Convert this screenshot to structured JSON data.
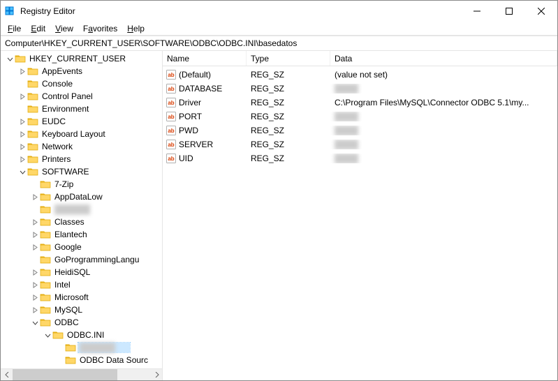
{
  "window": {
    "title": "Registry Editor"
  },
  "menu": {
    "file": "File",
    "edit": "Edit",
    "view": "View",
    "favorites": "Favorites",
    "help": "Help"
  },
  "address": "Computer\\HKEY_CURRENT_USER\\SOFTWARE\\ODBC\\ODBC.INI\\basedatos",
  "columns": {
    "name": "Name",
    "type": "Type",
    "data": "Data"
  },
  "tree": {
    "root": "HKEY_CURRENT_USER",
    "children": [
      {
        "label": "AppEvents",
        "expander": ">",
        "indent": 1
      },
      {
        "label": "Console",
        "expander": "",
        "indent": 1
      },
      {
        "label": "Control Panel",
        "expander": ">",
        "indent": 1
      },
      {
        "label": "Environment",
        "expander": "",
        "indent": 1
      },
      {
        "label": "EUDC",
        "expander": ">",
        "indent": 1
      },
      {
        "label": "Keyboard Layout",
        "expander": ">",
        "indent": 1
      },
      {
        "label": "Network",
        "expander": ">",
        "indent": 1
      },
      {
        "label": "Printers",
        "expander": ">",
        "indent": 1
      },
      {
        "label": "SOFTWARE",
        "expander": "v",
        "indent": 1
      },
      {
        "label": "7-Zip",
        "expander": "",
        "indent": 2
      },
      {
        "label": "AppDataLow",
        "expander": ">",
        "indent": 2
      },
      {
        "label": "",
        "expander": "",
        "indent": 2,
        "blur": true
      },
      {
        "label": "Classes",
        "expander": ">",
        "indent": 2
      },
      {
        "label": "Elantech",
        "expander": ">",
        "indent": 2
      },
      {
        "label": "Google",
        "expander": ">",
        "indent": 2
      },
      {
        "label": "GoProgrammingLangu",
        "expander": "",
        "indent": 2
      },
      {
        "label": "HeidiSQL",
        "expander": ">",
        "indent": 2
      },
      {
        "label": "Intel",
        "expander": ">",
        "indent": 2
      },
      {
        "label": "Microsoft",
        "expander": ">",
        "indent": 2
      },
      {
        "label": "MySQL",
        "expander": ">",
        "indent": 2
      },
      {
        "label": "ODBC",
        "expander": "v",
        "indent": 2
      },
      {
        "label": "ODBC.INI",
        "expander": "v",
        "indent": 3
      },
      {
        "label": "",
        "expander": "",
        "indent": 4,
        "blur": true,
        "selected": true
      },
      {
        "label": "ODBC Data Sourc",
        "expander": "",
        "indent": 4
      }
    ]
  },
  "rows": [
    {
      "name": "(Default)",
      "type": "REG_SZ",
      "data": "(value not set)"
    },
    {
      "name": "DATABASE",
      "type": "REG_SZ",
      "data": "",
      "blur": true
    },
    {
      "name": "Driver",
      "type": "REG_SZ",
      "data": "C:\\Program Files\\MySQL\\Connector ODBC 5.1\\my..."
    },
    {
      "name": "PORT",
      "type": "REG_SZ",
      "data": "",
      "blur": true
    },
    {
      "name": "PWD",
      "type": "REG_SZ",
      "data": "",
      "blur": true
    },
    {
      "name": "SERVER",
      "type": "REG_SZ",
      "data": "",
      "blur": true
    },
    {
      "name": "UID",
      "type": "REG_SZ",
      "data": "",
      "blur": true
    }
  ]
}
